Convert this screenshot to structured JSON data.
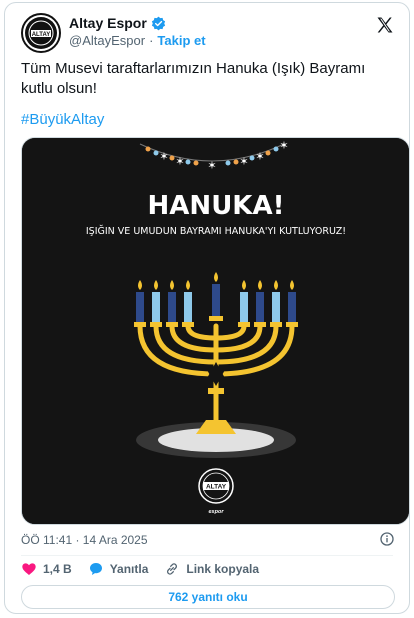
{
  "account": {
    "display_name": "Altay Espor",
    "handle": "@AltayEspor",
    "separator": "·",
    "follow_label": "Takip et",
    "avatar_text": "ALTAY"
  },
  "tweet": {
    "text": "Tüm Musevi taraftarlarımızın Hanuka (Işık) Bayramı kutlu olsun!",
    "hashtag": "#BüyükAltay",
    "timestamp": "ÖÖ 11:41 · 14 Ara 2025"
  },
  "media": {
    "title": "HANUKA!",
    "subtitle": "IŞIĞIN VE UMUDUN BAYRAMI HANUKA'YI KUTLUYORUZ!",
    "logo_text": "ALTAY",
    "logo_caption": "espor",
    "colors": {
      "background": "#141414",
      "menorah": "#f4c430",
      "candle_dark": "#2e4a8b",
      "candle_light": "#8ec9ea"
    }
  },
  "actions": {
    "like_count": "1,4 B",
    "reply_label": "Yanıtla",
    "copy_link_label": "Link kopyala",
    "read_replies_label": "762 yanıtı oku"
  },
  "colors": {
    "accent": "#1d9bf0",
    "like": "#f91880",
    "verified": "#1d9bf0"
  }
}
